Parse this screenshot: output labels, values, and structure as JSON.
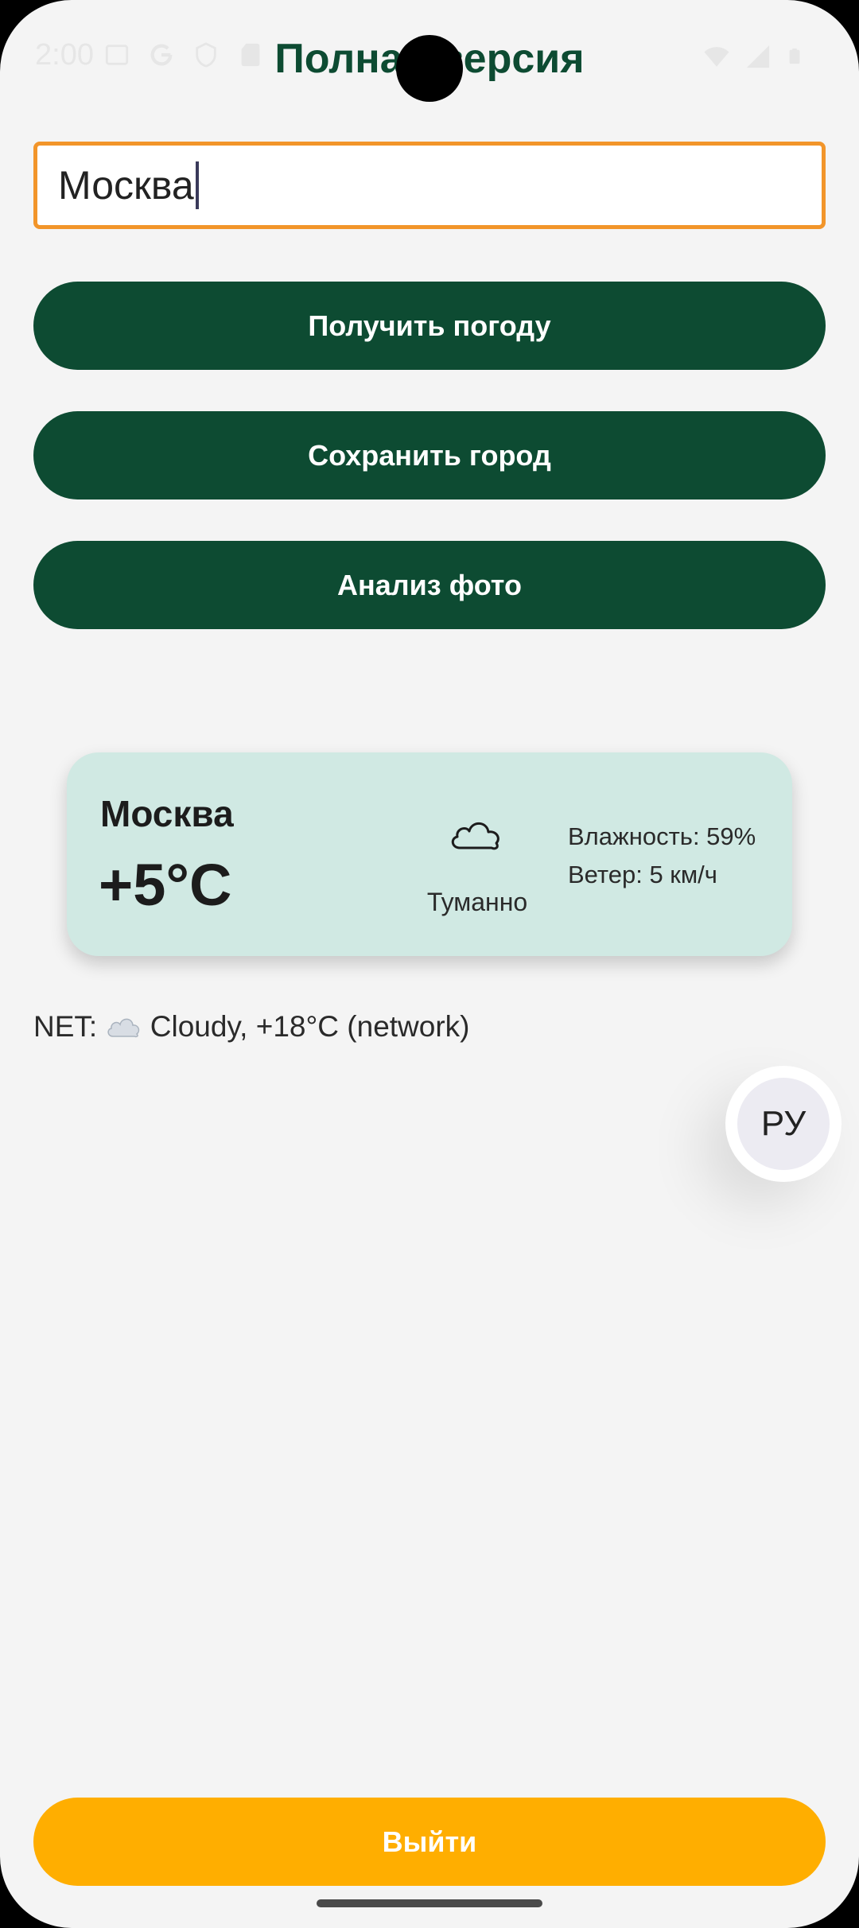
{
  "status_bar": {
    "time": "2:00"
  },
  "header": {
    "title": "Полная версия"
  },
  "search": {
    "value": "Москва"
  },
  "actions": {
    "get_weather": "Получить погоду",
    "save_city": "Сохранить город",
    "analyze_photo": "Анализ фото"
  },
  "weather_card": {
    "city": "Москва",
    "temperature": "+5°C",
    "icon": "cloud-icon",
    "condition": "Туманно",
    "humidity": "Влажность: 59%",
    "wind": "Ветер: 5 км/ч"
  },
  "network_info": {
    "prefix": "NET: ",
    "icon": "cloud-emoji",
    "text": " Cloudy, +18°C (network)"
  },
  "language": {
    "label": "РУ"
  },
  "footer": {
    "logout": "Выйти"
  },
  "colors": {
    "primary": "#0d4b32",
    "accent": "#ffae00",
    "input_border": "#f2952a",
    "card_bg": "#d0e9e3"
  }
}
